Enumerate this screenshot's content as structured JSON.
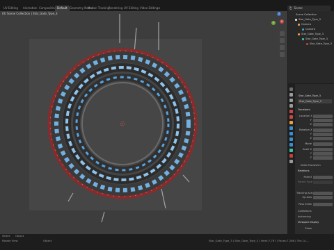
{
  "workspace_tabs": [
    "UV Editing",
    "Animation",
    "Compositing",
    "Default",
    "Geometry Nodes",
    "Motion Tracking",
    "Rendering",
    "UV Editing",
    "Video Editing"
  ],
  "active_tab": "Default",
  "add_tab_icon": "plus-icon",
  "scene": {
    "label": "Scene"
  },
  "viewport": {
    "header_text": "(0) Scene Collection | Star_Gate_Type_3",
    "pivot_label": "Global",
    "object_menu": "Object",
    "mode_label": "Object"
  },
  "outliner": {
    "rows": [
      {
        "label": "Scene Collection",
        "indent": 0,
        "icon_color": "#d0d0d0",
        "selected": false
      },
      {
        "label": "Star_Gate_Type_3",
        "indent": 1,
        "icon_color": "#e0e0e0",
        "selected": false
      },
      {
        "label": "Camera",
        "indent": 2,
        "icon_color": "#e8a040",
        "selected": false
      },
      {
        "label": "Camera",
        "indent": 3,
        "icon_color": "#40a0c0",
        "selected": false
      },
      {
        "label": "Star_Gate_Type_3",
        "indent": 2,
        "icon_color": "#e8a040",
        "selected": false
      },
      {
        "label": "Star_Gate_Type_3",
        "indent": 3,
        "icon_color": "#40c0a0",
        "selected": false
      },
      {
        "label": "Star_Gate_Type_3",
        "indent": 4,
        "icon_color": "#c04040",
        "selected": false
      }
    ]
  },
  "properties": {
    "object_name": "Star_Gate_Type_3",
    "name_field": "Star_Gate_Type_3",
    "sections": {
      "transform": "Transform",
      "location": "Location X",
      "rotation": "Rotation X",
      "mode": "Mode",
      "scale": "Scale X",
      "delta": "Delta Transform",
      "relations": "Relations",
      "parent": "Parent",
      "parent_type": "Parent Type",
      "tracking": "Tracking Axis",
      "up_axis": "Up Axis",
      "pass_index": "Pass Index",
      "collections": "Collections",
      "instancing": "Instancing",
      "viewport_display": "Viewport Display",
      "show": "Show"
    },
    "axis_y": "Y",
    "axis_z": "Z"
  },
  "status": {
    "left1": "Select",
    "left2": "Object",
    "left3": "Rotate View",
    "right": "Star_Gate_Type_3 | Star_Gate_Type_3 | Verts:7,787 | Faces:7,286 | Tris:14,..."
  },
  "colors": {
    "ring_red": "#8b2a2a",
    "panel_blue": "#5fb7ff",
    "gizmo_x": "#c84848",
    "gizmo_y": "#6fa83a",
    "gizmo_z": "#3a73c8"
  }
}
